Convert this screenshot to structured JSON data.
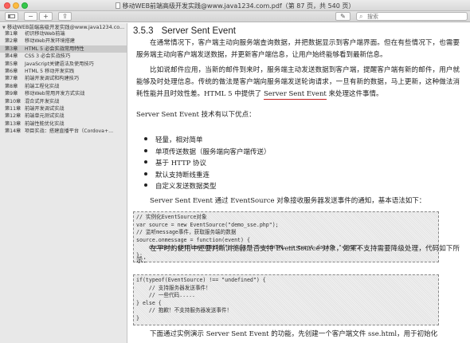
{
  "window": {
    "title": "移动WEB前端高级开发实践@www.java1234.com.pdf（第 87 页，共 540 页）"
  },
  "toolbar": {
    "sidebar_icon": "sidebar-toggle-icon",
    "zoom_out_glyph": "−",
    "zoom_in_glyph": "+",
    "share_glyph": "⇪",
    "markup_glyph": "✎",
    "rotate_glyph": "⌄",
    "search_placeholder": "搜索"
  },
  "sidebar": {
    "root": "移动WEB前端高级开发实践@www.java1234.co...",
    "items": [
      {
        "ch": "第1章",
        "title": "初识移动Web前端"
      },
      {
        "ch": "第2章",
        "title": "移动Web开发环境搭建"
      },
      {
        "ch": "第3章",
        "title": "HTML 5 必会实战常用特性"
      },
      {
        "ch": "第4章",
        "title": "CSS 3 必会实战技巧"
      },
      {
        "ch": "第5章",
        "title": "JavaScript关键语法及使用技巧"
      },
      {
        "ch": "第6章",
        "title": "HTML 5 移动开发实践"
      },
      {
        "ch": "第7章",
        "title": "前端开发调试和构建技巧"
      },
      {
        "ch": "第8章",
        "title": "前端工程化实战"
      },
      {
        "ch": "第9章",
        "title": "移动Web常用开发方式实战"
      },
      {
        "ch": "第10章",
        "title": "混合式开发实战"
      },
      {
        "ch": "第11章",
        "title": "前端开发调试实战"
      },
      {
        "ch": "第12章",
        "title": "前端单元测试实战"
      },
      {
        "ch": "第13章",
        "title": "前端性能优化实战"
      },
      {
        "ch": "第14章",
        "title": "项目实战：搭建直播平台（Cordova+..."
      }
    ],
    "selected_index": 2
  },
  "page": {
    "section_number": "3.5.3",
    "section_title": "Server Sent Event",
    "p1": "在通常情况下，客户端主动向服务端查询数据，并把数据显示到客户端界面。但在有些情况下，也需要服务端主动向客户端发送数据，并更新客户端信息，让用户始终能够看到最新信息。",
    "p2_before": "比如说邮件应用，当新的邮件到来时，服务端主动发送数据到客户端，提醒客户端有新的邮件，用户就能够及时处理信息。传统的做法是客户端向服务端发送轮询请求，一旦有新的数据，马上更新，这种做法消耗性能并且时效性差。HTML 5 中提供了 ",
    "p2_underlined": "Server Sent Event",
    "p2_after": " 来处理这件事情。",
    "p3": "Server Sent Event 技术有以下优点：",
    "features": [
      "轻量，相对简单",
      "单项传送数据（服务端向客户端传送）",
      "基于 HTTP 协议",
      "默认支持断线重连",
      "自定义发送数据类型"
    ],
    "p4": "Server Sent Event 通过 EventSource 对象接收服务器发送事件的通知，基本语法如下：",
    "code1": "// 实例化EventSource对象\nvar source = new EventSource(\"demo_sse.php\");\n// 监听message事件，获取服务端的数据\nsource.onmessage = function(event) {\n    document.getElementById(\"result\").innerHTML += event.data + \"<br>\";\n};",
    "p5": "在平时的使用中还要判断浏览器是否支持 EventSource 对象，如果不支持需要降级处理，代码如下所示：",
    "code2": "if(typeof(EventSource) !== \"undefined\") {\n    // 支持服务器发送事件！\n    // 一些代码.....\n} else {\n    // 抱歉！不支持服务器发送事件！\n}",
    "p6": "下面通过实例演示 Server Sent Event 的功能，先创建一个客户端文件 sse.html，用于初始化"
  },
  "colors": {
    "underline": "#c51f1f",
    "sidebar_bg": "#e8e8e8",
    "selected_bg": "#cbcbcb"
  }
}
